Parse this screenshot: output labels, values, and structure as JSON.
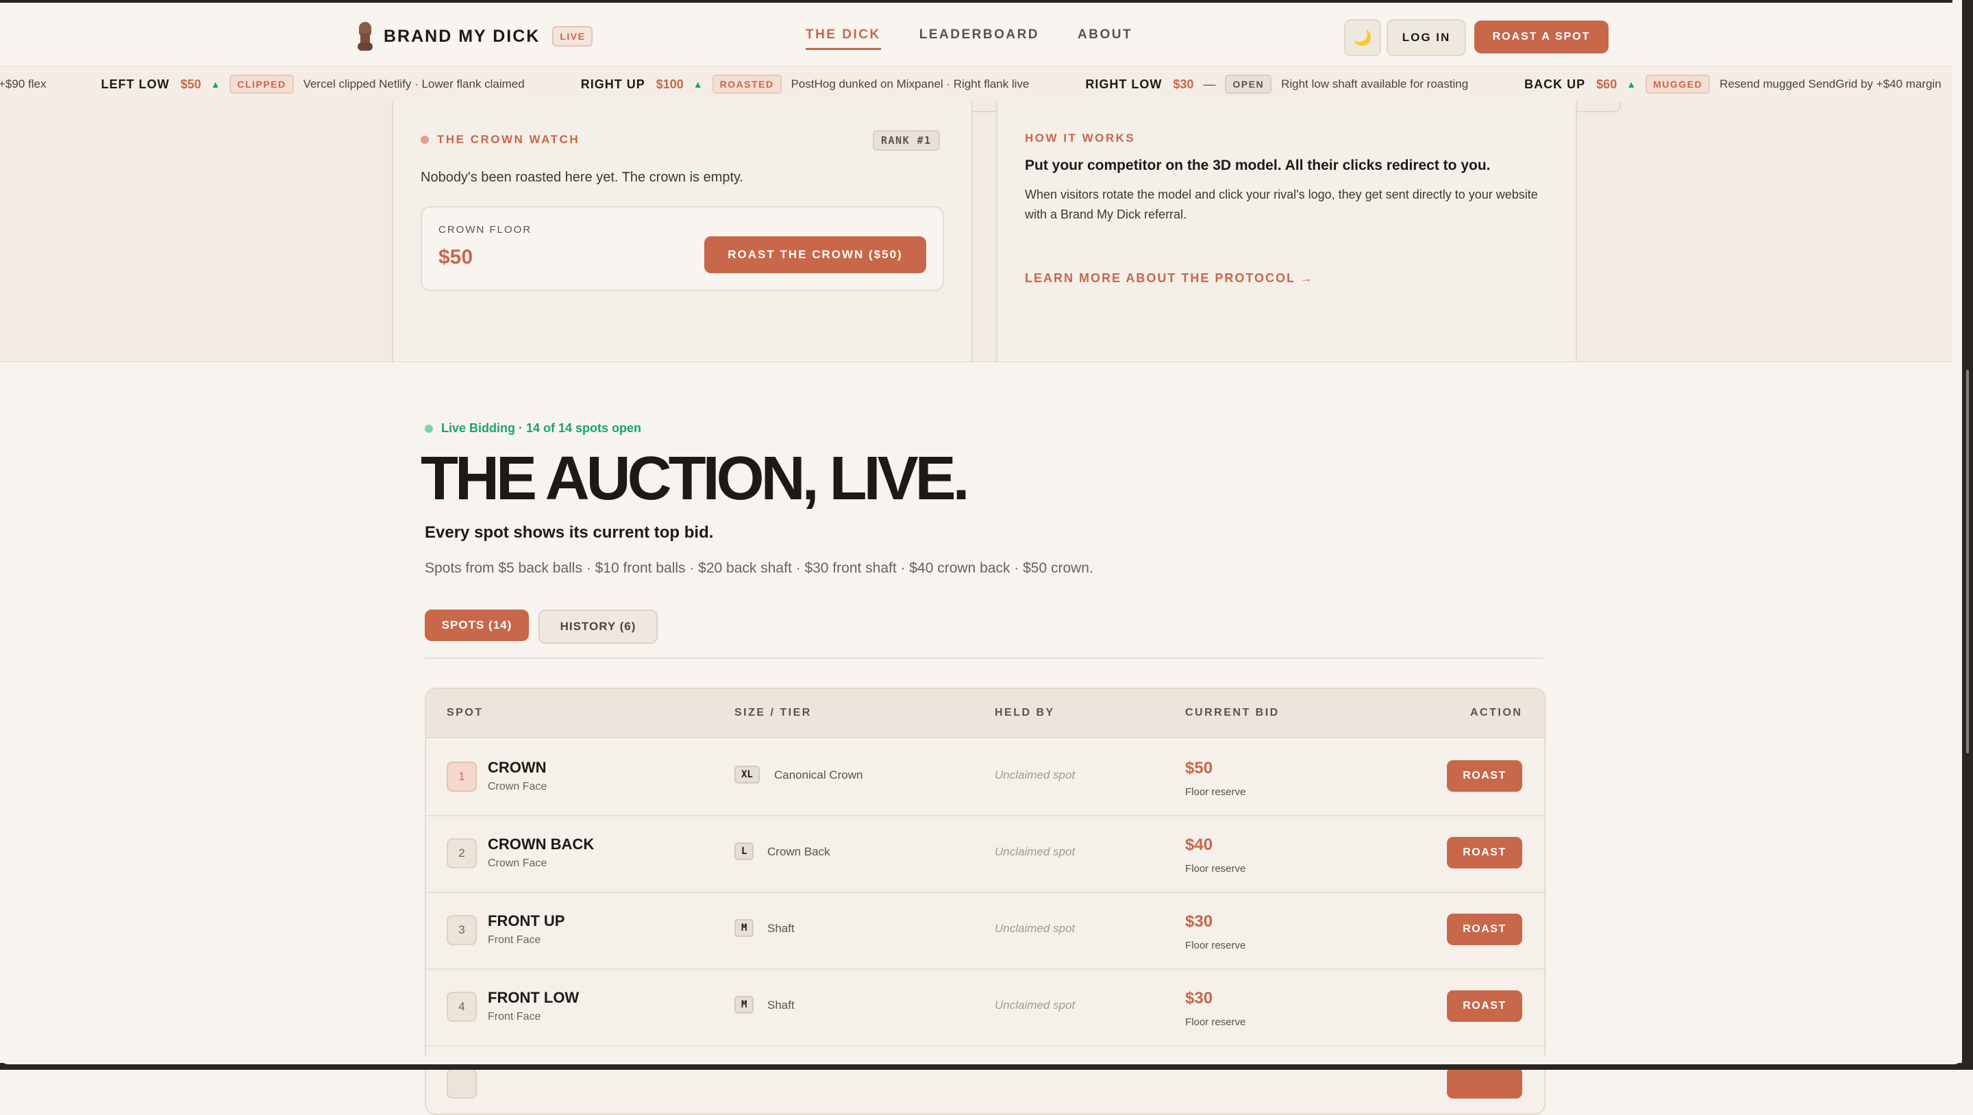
{
  "header": {
    "brand": "BRAND MY DICK",
    "live_badge": "LIVE",
    "nav": [
      "THE DICK",
      "LEADERBOARD",
      "ABOUT"
    ],
    "moon_icon": "🌙",
    "login": "LOG IN",
    "roast_spot": "ROAST A SPOT"
  },
  "ticker": {
    "lead_fragment": "+$90 flex",
    "items": [
      {
        "spot": "LEFT LOW",
        "price": "$50",
        "arrow": "▲",
        "badge": "CLIPPED",
        "text": "Vercel clipped Netlify · Lower flank claimed"
      },
      {
        "spot": "RIGHT UP",
        "price": "$100",
        "arrow": "▲",
        "badge": "ROASTED",
        "text": "PostHog dunked on Mixpanel · Right flank live"
      },
      {
        "spot": "RIGHT LOW",
        "price": "$30",
        "arrow": "—",
        "badge": "OPEN",
        "text": "Right low shaft available for roasting"
      },
      {
        "spot": "BACK UP",
        "price": "$60",
        "arrow": "▲",
        "badge": "MUGGED",
        "text": "Resend mugged SendGrid by +$40 margin"
      }
    ]
  },
  "crown_watch": {
    "label": "THE CROWN WATCH",
    "rank": "RANK #1",
    "empty_text": "Nobody's been roasted here yet. The crown is empty.",
    "floor_label": "CROWN FLOOR",
    "floor_value": "$50",
    "button": "ROAST THE CROWN ($50)"
  },
  "how_it_works": {
    "label": "HOW IT WORKS",
    "title": "Put your competitor on the 3D model. All their clicks redirect to you.",
    "body": "When visitors rotate the model and click your rival's logo, they get sent directly to your website with a Brand My Dick referral.",
    "link": "LEARN MORE ABOUT THE PROTOCOL →"
  },
  "auction": {
    "live_text": "Live Bidding · 14 of 14 spots open",
    "title": "THE AUCTION, LIVE.",
    "subhead": "Every spot shows its current top bid.",
    "spots_text": "Spots from $5 back balls · $10 front balls · $20 back shaft · $30 front shaft · $40 crown back · $50 crown.",
    "tabs": {
      "spots": "SPOTS (14)",
      "history": "HISTORY (6)"
    }
  },
  "table": {
    "headers": {
      "spot": "SPOT",
      "size": "SIZE / TIER",
      "held": "HELD BY",
      "bid": "CURRENT BID",
      "action": "ACTION"
    },
    "rows": [
      {
        "rank": "1",
        "name": "CROWN",
        "face": "Crown Face",
        "size": "XL",
        "tier": "Canonical Crown",
        "held": "Unclaimed spot",
        "bid": "$50",
        "bid_note": "Floor reserve",
        "action": "ROAST"
      },
      {
        "rank": "2",
        "name": "CROWN BACK",
        "face": "Crown Face",
        "size": "L",
        "tier": "Crown Back",
        "held": "Unclaimed spot",
        "bid": "$40",
        "bid_note": "Floor reserve",
        "action": "ROAST"
      },
      {
        "rank": "3",
        "name": "FRONT UP",
        "face": "Front Face",
        "size": "M",
        "tier": "Shaft",
        "held": "Unclaimed spot",
        "bid": "$30",
        "bid_note": "Floor reserve",
        "action": "ROAST"
      },
      {
        "rank": "4",
        "name": "FRONT LOW",
        "face": "Front Face",
        "size": "M",
        "tier": "Shaft",
        "held": "Unclaimed spot",
        "bid": "$30",
        "bid_note": "Floor reserve",
        "action": "ROAST"
      }
    ]
  },
  "colors": {
    "accent": "#c8674a",
    "live_green": "#1ba46a",
    "background": "#f7f3ee"
  }
}
